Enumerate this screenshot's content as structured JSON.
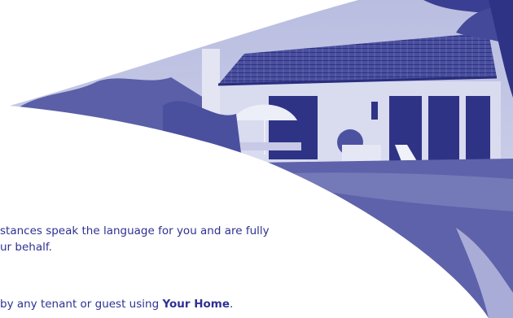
{
  "photo": {
    "subject": "villa-photo",
    "tint_color": "#3a3f94",
    "light_color": "#c5c8e6"
  },
  "text": {
    "line1": "stances speak the language for you and are fully",
    "line2": "ur behalf.",
    "line3_prefix": "by any tenant or guest using ",
    "line3_bold": "Your Home",
    "line3_suffix": "."
  },
  "colors": {
    "text": "#2e3192",
    "background": "#ffffff"
  }
}
